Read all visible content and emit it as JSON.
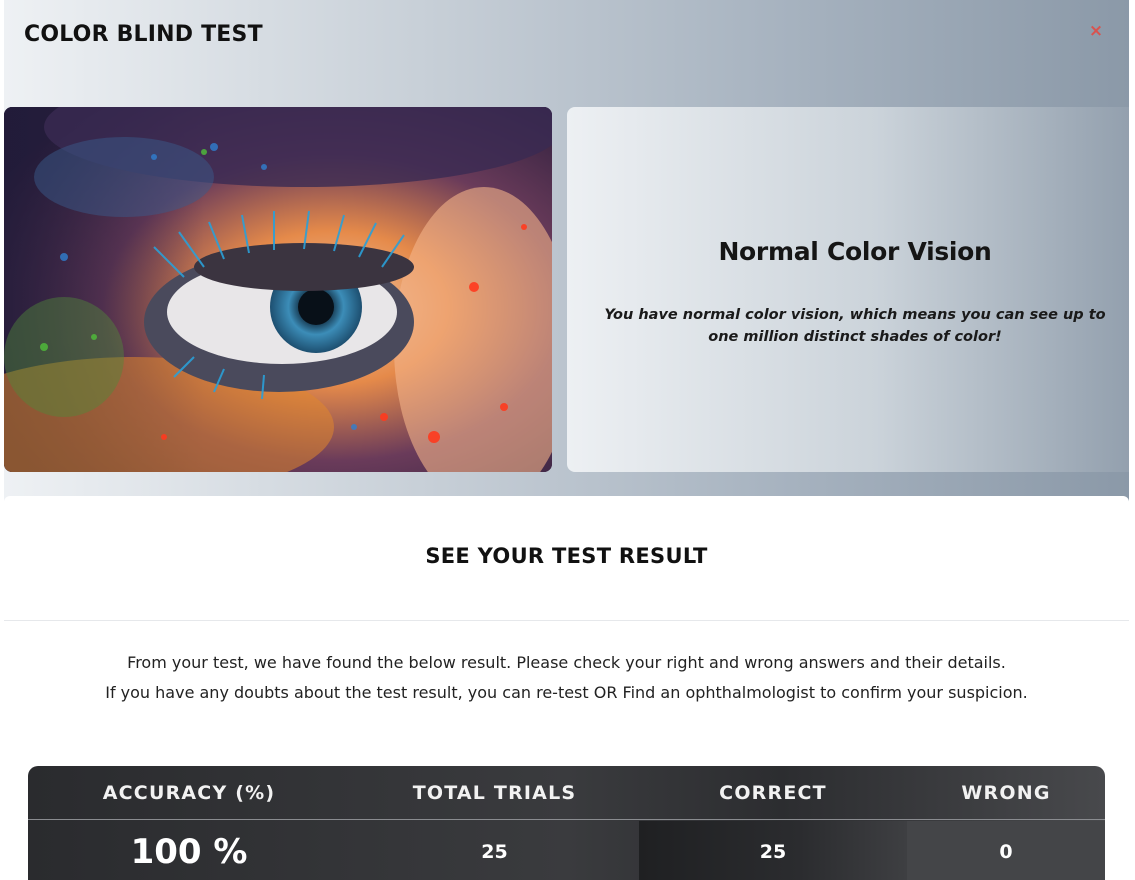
{
  "modal": {
    "title": "COLOR BLIND TEST",
    "close_icon": "×"
  },
  "hero": {
    "image_icon": "colorful-eye-photo"
  },
  "result": {
    "title": "Normal Color Vision",
    "description": "You have normal color vision, which means you can see up to one million distinct shades of color!"
  },
  "panel": {
    "title": "SEE YOUR TEST RESULT",
    "line1": "From your test, we have found the below result. Please check your right and wrong answers and their details.",
    "line2": "If you have any doubts about the test result, you can re-test OR Find an ophthalmologist to confirm your suspicion."
  },
  "stats": {
    "headers": [
      "ACCURACY (%)",
      "TOTAL TRIALS",
      "CORRECT",
      "WRONG"
    ],
    "values": [
      "100 %",
      "25",
      "25",
      "0"
    ]
  },
  "colors": {
    "close": "#d9534f",
    "stats_bg": "#2a2b2e"
  }
}
